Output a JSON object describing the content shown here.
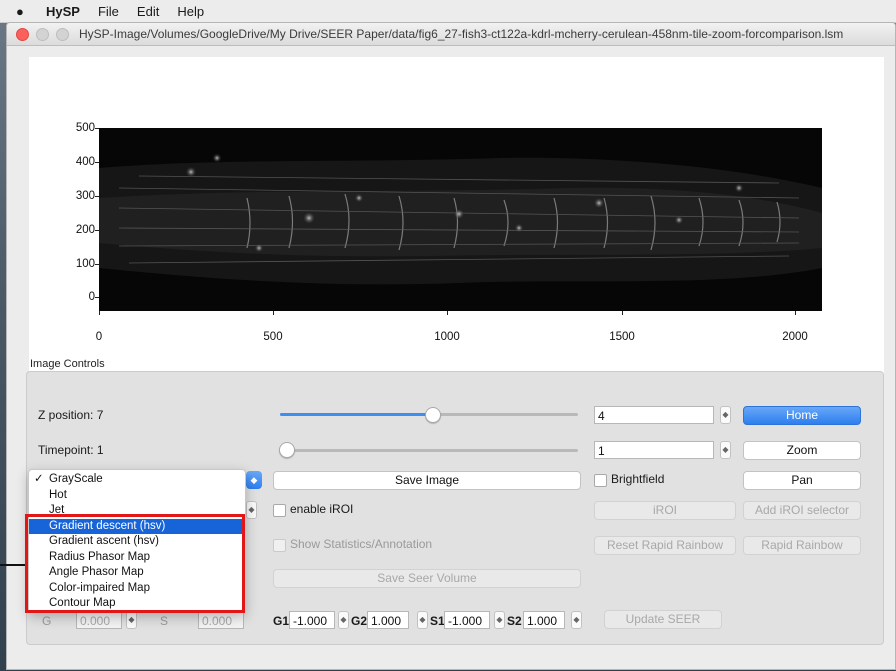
{
  "menubar": {
    "app": "HySP",
    "items": [
      "File",
      "Edit",
      "Help"
    ]
  },
  "window": {
    "title": "HySP-Image/Volumes/GoogleDrive/My Drive/SEER Paper/data/fig6_27-fish3-ct122a-kdrl-mcherry-cerulean-458nm-tile-zoom-forcomparison.lsm"
  },
  "plot": {
    "y_ticks": [
      "500",
      "400",
      "300",
      "200",
      "100",
      "0"
    ],
    "x_ticks": [
      "0",
      "500",
      "1000",
      "1500",
      "2000"
    ]
  },
  "controls": {
    "section_label": "Image Controls",
    "z_label": "Z position: 7",
    "z_value": "4",
    "z_slider": 0.51,
    "time_label": "Timepoint: 1",
    "time_value": "1",
    "time_slider": 0.0,
    "home": "Home",
    "zoom": "Zoom",
    "pan": "Pan",
    "save_image": "Save Image",
    "brightfield": "Brightfield",
    "enable_iroi": "enable iROI",
    "iroi": "iROI",
    "add_iroi": "Add iROI selector",
    "show_stats": "Show Statistics/Annotation",
    "reset_rainbow": "Reset Rapid Rainbow",
    "rapid_rainbow": "Rapid Rainbow",
    "save_seer": "Save Seer Volume",
    "update_seer": "Update SEER",
    "g_label": "G",
    "g_value": "0.000",
    "s_label": "S",
    "s_value": "0.000",
    "g1_label": "G1",
    "g1_value": "-1.000",
    "g2_label": "G2",
    "g2_value": "1.000",
    "s1_label": "S1",
    "s1_value": "-1.000",
    "s2_label": "S2",
    "s2_value": "1.000"
  },
  "colormap_menu": {
    "items": [
      "GrayScale",
      "Hot",
      "Jet",
      "Gradient descent (hsv)",
      "Gradient ascent (hsv)",
      "Radius Phasor Map",
      "Angle Phasor Map",
      "Color-impaired Map",
      "Contour Map"
    ],
    "checked": "GrayScale",
    "highlighted": "Gradient descent (hsv)",
    "check_mark": "✓"
  },
  "colors": {
    "accent": "#2c7ff0",
    "highlight": "#1763d8",
    "annotation": "#e21616"
  }
}
